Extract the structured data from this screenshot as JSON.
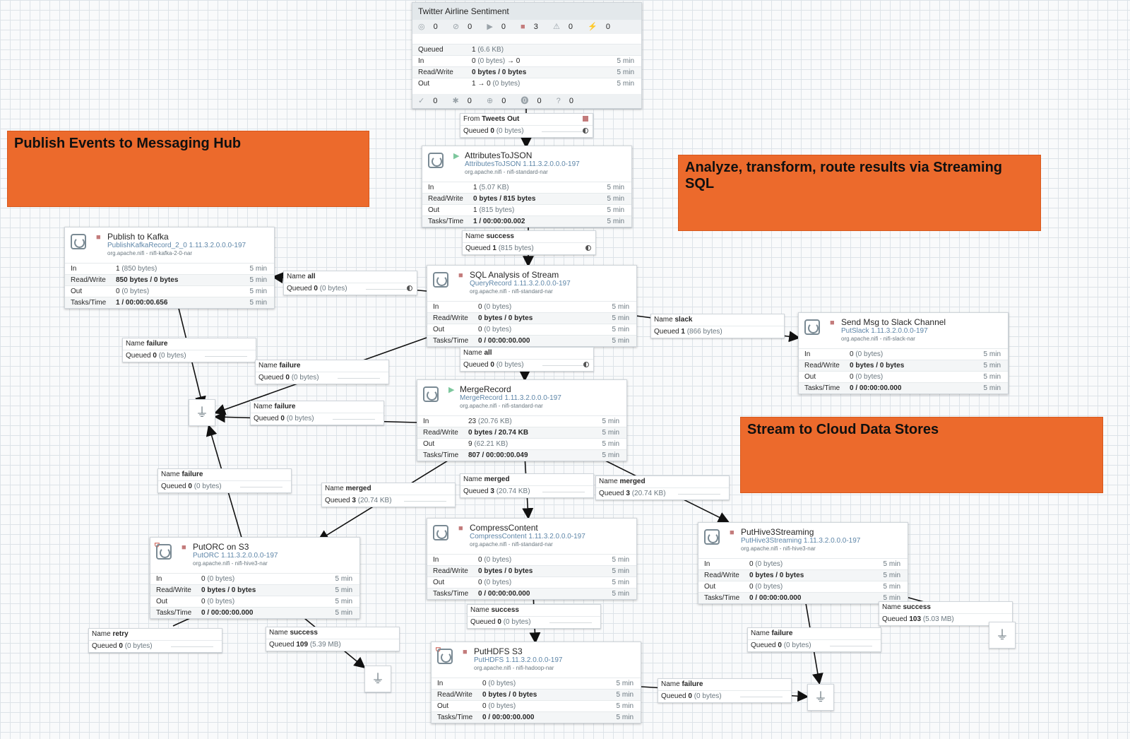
{
  "labels": {
    "publish": "Publish Events to Messaging Hub",
    "analyze": "Analyze, transform, route results via Streaming SQL",
    "stream": "Stream to Cloud Data Stores"
  },
  "process_group": {
    "title": "Twitter Airline Sentiment",
    "status_counts": [
      "0",
      "0",
      "0",
      "3",
      "0",
      "0"
    ],
    "queued_label": "Queued",
    "queued_value": "1",
    "queued_size": "(6.6 KB)",
    "in_label": "In",
    "in_value": "0",
    "in_size": "(0 bytes)",
    "in_arrow": "→ 0",
    "in_time": "5 min",
    "rw_label": "Read/Write",
    "rw_value": "0 bytes / 0 bytes",
    "rw_time": "5 min",
    "out_label": "Out",
    "out_value": "1 → 0",
    "out_size": "(0 bytes)",
    "out_time": "5 min",
    "footer_counts": [
      "0",
      "0",
      "0",
      "0",
      "0"
    ]
  },
  "processors": {
    "attr": {
      "name": "AttributesToJSON",
      "type": "AttributesToJSON 1.11.3.2.0.0.0-197",
      "bundle": "org.apache.nifi - nifi-standard-nar",
      "in": "1",
      "in_size": "(5.07 KB)",
      "rw": "0 bytes / 815 bytes",
      "out": "1",
      "out_size": "(815 bytes)",
      "tasks": "1 / 00:00:00.002",
      "time": "5 min"
    },
    "kafka": {
      "name": "Publish to Kafka",
      "type": "PublishKafkaRecord_2_0 1.11.3.2.0.0.0-197",
      "bundle": "org.apache.nifi - nifi-kafka-2-0-nar",
      "in": "1",
      "in_size": "(850 bytes)",
      "rw": "850 bytes / 0 bytes",
      "out": "0",
      "out_size": "(0 bytes)",
      "tasks": "1 / 00:00:00.656",
      "time": "5 min"
    },
    "sql": {
      "name": "SQL Analysis of Stream",
      "type": "QueryRecord 1.11.3.2.0.0.0-197",
      "bundle": "org.apache.nifi - nifi-standard-nar",
      "in": "0",
      "in_size": "(0 bytes)",
      "rw": "0 bytes / 0 bytes",
      "out": "0",
      "out_size": "(0 bytes)",
      "tasks": "0 / 00:00:00.000",
      "time": "5 min"
    },
    "slack": {
      "name": "Send Msg to Slack Channel",
      "type": "PutSlack 1.11.3.2.0.0.0-197",
      "bundle": "org.apache.nifi - nifi-slack-nar",
      "in": "0",
      "in_size": "(0 bytes)",
      "rw": "0 bytes / 0 bytes",
      "out": "0",
      "out_size": "(0 bytes)",
      "tasks": "0 / 00:00:00.000",
      "time": "5 min"
    },
    "merge": {
      "name": "MergeRecord",
      "type": "MergeRecord 1.11.3.2.0.0.0-197",
      "bundle": "org.apache.nifi - nifi-standard-nar",
      "in": "23",
      "in_size": "(20.76 KB)",
      "rw": "0 bytes / 20.74 KB",
      "out": "9",
      "out_size": "(62.21 KB)",
      "tasks": "807 / 00:00:00.049",
      "time": "5 min"
    },
    "putorc": {
      "name": "PutORC on S3",
      "type": "PutORC 1.11.3.2.0.0.0-197",
      "bundle": "org.apache.nifi - nifi-hive3-nar",
      "in": "0",
      "in_size": "(0 bytes)",
      "rw": "0 bytes / 0 bytes",
      "out": "0",
      "out_size": "(0 bytes)",
      "tasks": "0 / 00:00:00.000",
      "time": "5 min"
    },
    "compress": {
      "name": "CompressContent",
      "type": "CompressContent 1.11.3.2.0.0.0-197",
      "bundle": "org.apache.nifi - nifi-standard-nar",
      "in": "0",
      "in_size": "(0 bytes)",
      "rw": "0 bytes / 0 bytes",
      "out": "0",
      "out_size": "(0 bytes)",
      "tasks": "0 / 00:00:00.000",
      "time": "5 min"
    },
    "hive": {
      "name": "PutHive3Streaming",
      "type": "PutHive3Streaming 1.11.3.2.0.0.0-197",
      "bundle": "org.apache.nifi - nifi-hive3-nar",
      "in": "0",
      "in_size": "(0 bytes)",
      "rw": "0 bytes / 0 bytes",
      "out": "0",
      "out_size": "(0 bytes)",
      "tasks": "0 / 00:00:00.000",
      "time": "5 min"
    },
    "hdfs": {
      "name": "PutHDFS S3",
      "type": "PutHDFS 1.11.3.2.0.0.0-197",
      "bundle": "org.apache.nifi - nifi-hadoop-nar",
      "in": "0",
      "in_size": "(0 bytes)",
      "rw": "0 bytes / 0 bytes",
      "out": "0",
      "out_size": "(0 bytes)",
      "tasks": "0 / 00:00:00.000",
      "time": "5 min"
    }
  },
  "row_labels": {
    "in": "In",
    "rw": "Read/Write",
    "out": "Out",
    "tasks": "Tasks/Time"
  },
  "connections": {
    "c_from": {
      "k1": "From",
      "v1": "Tweets Out",
      "k2": "Queued",
      "q": "0",
      "qs": "(0 bytes)"
    },
    "c_success1": {
      "k1": "Name",
      "v1": "success",
      "k2": "Queued",
      "q": "1",
      "qs": "(815 bytes)"
    },
    "c_all1": {
      "k1": "Name",
      "v1": "all",
      "k2": "Queued",
      "q": "0",
      "qs": "(0 bytes)"
    },
    "c_slack": {
      "k1": "Name",
      "v1": "slack",
      "k2": "Queued",
      "q": "1",
      "qs": "(866 bytes)"
    },
    "c_fail_kafka": {
      "k1": "Name",
      "v1": "failure",
      "k2": "Queued",
      "q": "0",
      "qs": "(0 bytes)"
    },
    "c_fail_sql": {
      "k1": "Name",
      "v1": "failure",
      "k2": "Queued",
      "q": "0",
      "qs": "(0 bytes)"
    },
    "c_all2": {
      "k1": "Name",
      "v1": "all",
      "k2": "Queued",
      "q": "0",
      "qs": "(0 bytes)"
    },
    "c_fail_merge": {
      "k1": "Name",
      "v1": "failure",
      "k2": "Queued",
      "q": "0",
      "qs": "(0 bytes)"
    },
    "c_fail_orc": {
      "k1": "Name",
      "v1": "failure",
      "k2": "Queued",
      "q": "0",
      "qs": "(0 bytes)"
    },
    "c_merged_l": {
      "k1": "Name",
      "v1": "merged",
      "k2": "Queued",
      "q": "3",
      "qs": "(20.74 KB)"
    },
    "c_merged_m": {
      "k1": "Name",
      "v1": "merged",
      "k2": "Queued",
      "q": "3",
      "qs": "(20.74 KB)"
    },
    "c_merged_r": {
      "k1": "Name",
      "v1": "merged",
      "k2": "Queued",
      "q": "3",
      "qs": "(20.74 KB)"
    },
    "c_retry": {
      "k1": "Name",
      "v1": "retry",
      "k2": "Queued",
      "q": "0",
      "qs": "(0 bytes)"
    },
    "c_success_orc": {
      "k1": "Name",
      "v1": "success",
      "k2": "Queued",
      "q": "109",
      "qs": "(5.39 MB)"
    },
    "c_success_comp": {
      "k1": "Name",
      "v1": "success",
      "k2": "Queued",
      "q": "0",
      "qs": "(0 bytes)"
    },
    "c_success_hive": {
      "k1": "Name",
      "v1": "success",
      "k2": "Queued",
      "q": "103",
      "qs": "(5.03 MB)"
    },
    "c_fail_hive": {
      "k1": "Name",
      "v1": "failure",
      "k2": "Queued",
      "q": "0",
      "qs": "(0 bytes)"
    },
    "c_fail_hdfs": {
      "k1": "Name",
      "v1": "failure",
      "k2": "Queued",
      "q": "0",
      "qs": "(0 bytes)"
    }
  },
  "funnel_icon": "funnel-icon"
}
